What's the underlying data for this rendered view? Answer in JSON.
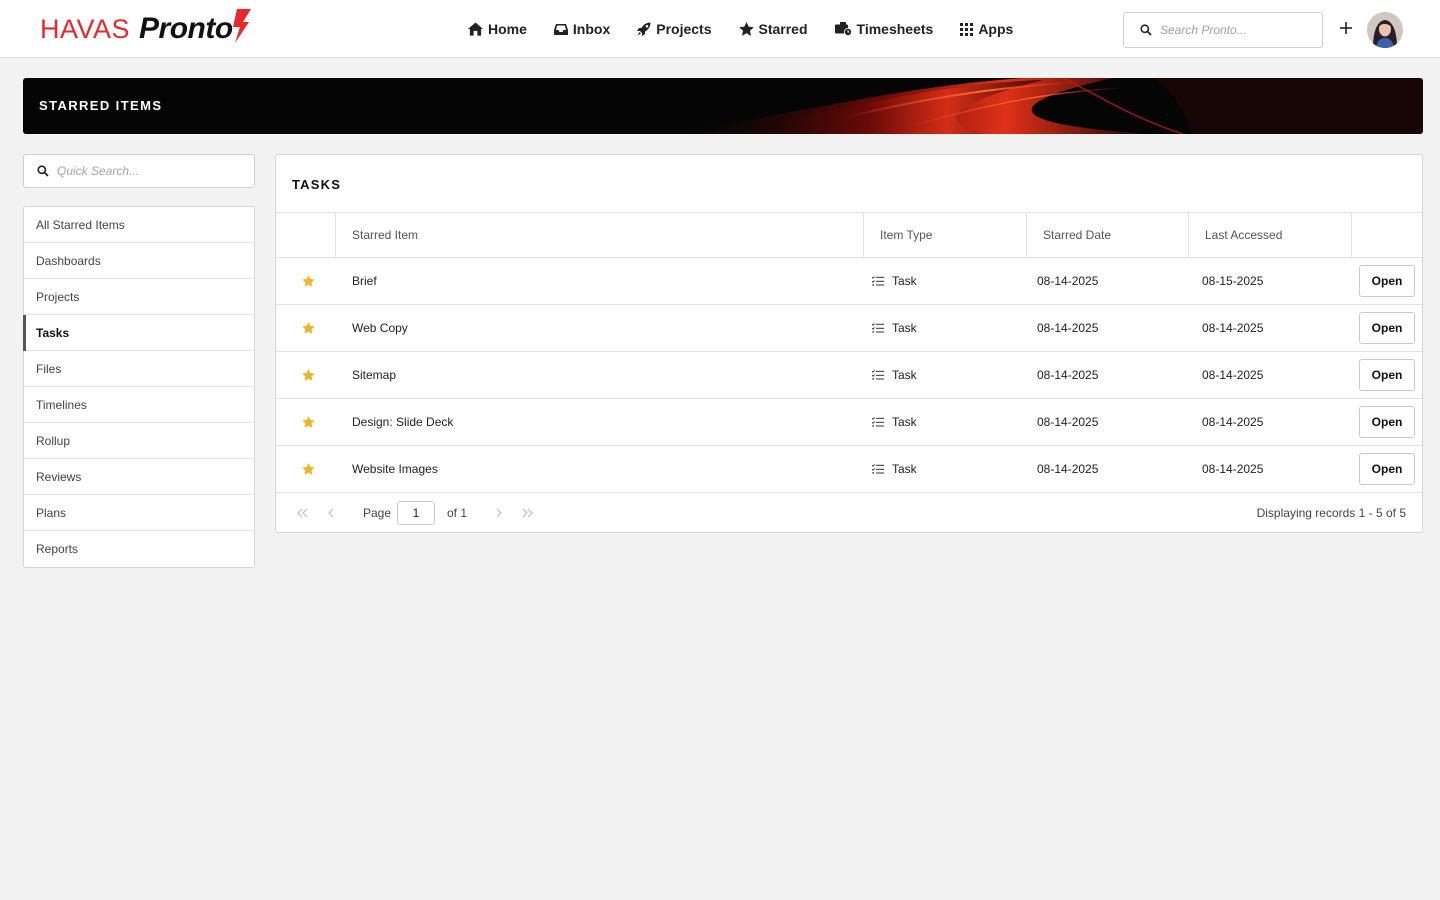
{
  "brand": {
    "name_left": "HAVAS",
    "name_right": "Pronto",
    "accent_color": "#e8282b"
  },
  "nav": {
    "items": [
      {
        "label": "Home",
        "icon": "home-icon"
      },
      {
        "label": "Inbox",
        "icon": "inbox-icon"
      },
      {
        "label": "Projects",
        "icon": "rocket-icon"
      },
      {
        "label": "Starred",
        "icon": "star-icon"
      },
      {
        "label": "Timesheets",
        "icon": "timesheet-icon"
      },
      {
        "label": "Apps",
        "icon": "apps-grid-icon"
      }
    ],
    "search_placeholder": "Search Pronto..."
  },
  "banner": {
    "title": "STARRED ITEMS"
  },
  "sidebar": {
    "search_placeholder": "Quick Search...",
    "items": [
      {
        "label": "All Starred Items"
      },
      {
        "label": "Dashboards"
      },
      {
        "label": "Projects"
      },
      {
        "label": "Tasks",
        "active": true
      },
      {
        "label": "Files"
      },
      {
        "label": "Timelines"
      },
      {
        "label": "Rollup"
      },
      {
        "label": "Reviews"
      },
      {
        "label": "Plans"
      },
      {
        "label": "Reports"
      }
    ]
  },
  "panel": {
    "title": "TASKS",
    "columns": [
      "Starred Item",
      "Item Type",
      "Starred Date",
      "Last Accessed"
    ],
    "open_label": "Open",
    "star_color": "#f0b323",
    "rows": [
      {
        "item": "Brief",
        "type": "Task",
        "starred": "08-14-2025",
        "accessed": "08-15-2025"
      },
      {
        "item": "Web Copy",
        "type": "Task",
        "starred": "08-14-2025",
        "accessed": "08-14-2025"
      },
      {
        "item": "Sitemap",
        "type": "Task",
        "starred": "08-14-2025",
        "accessed": "08-14-2025"
      },
      {
        "item": "Design: Slide Deck",
        "type": "Task",
        "starred": "08-14-2025",
        "accessed": "08-14-2025"
      },
      {
        "item": "Website Images",
        "type": "Task",
        "starred": "08-14-2025",
        "accessed": "08-14-2025"
      }
    ]
  },
  "pager": {
    "page_label": "Page",
    "page_value": "1",
    "of_label": "of 1",
    "display_text": "Displaying records 1 - 5 of 5"
  }
}
